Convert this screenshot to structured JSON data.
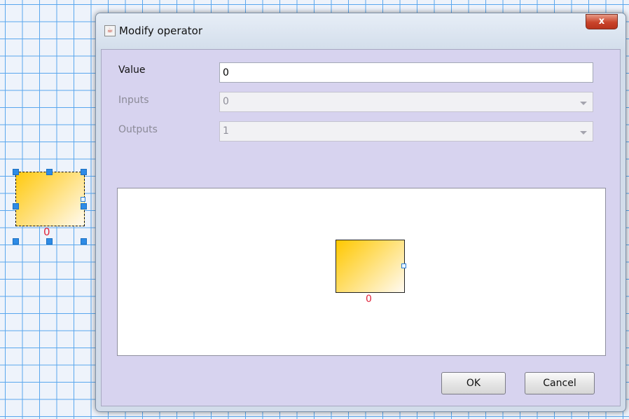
{
  "canvas": {
    "block_label": "0"
  },
  "dialog": {
    "title": "Modify operator",
    "close_symbol": "x",
    "fields": {
      "value_label": "Value",
      "value": "0",
      "inputs_label": "Inputs",
      "inputs_selected": "0",
      "outputs_label": "Outputs",
      "outputs_selected": "1"
    },
    "preview": {
      "block_label": "0"
    },
    "buttons": {
      "ok": "OK",
      "cancel": "Cancel"
    }
  },
  "colors": {
    "grid_line": "#5aa7ee",
    "dialog_client": "#d7d3ef",
    "block_gradient_start": "#ffc800",
    "label_red": "#e0243a"
  },
  "icons": {
    "title_icon": "java-cup-icon",
    "close": "close-icon",
    "dropdown": "chevron-down-icon"
  }
}
